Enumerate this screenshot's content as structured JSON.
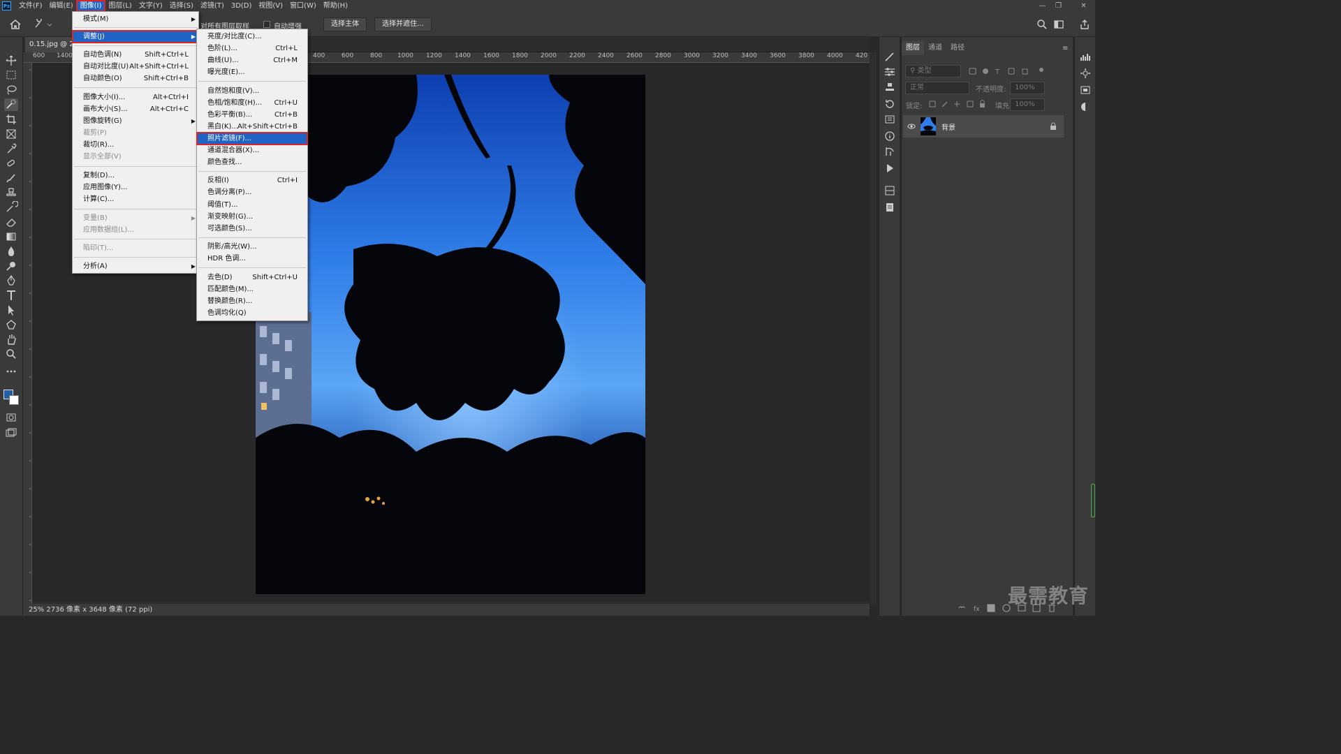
{
  "app": {
    "logo": "Ps"
  },
  "menubar": {
    "items": [
      "文件(F)",
      "编辑(E)",
      "图像(I)",
      "图层(L)",
      "文字(Y)",
      "选择(S)",
      "滤镜(T)",
      "3D(D)",
      "视图(V)",
      "窗口(W)",
      "帮助(H)"
    ],
    "active_index": 2
  },
  "options_bar": {
    "sample_all_layers": "对所有图层取样",
    "auto_enhance": "自动增强",
    "select_subject": "选择主体",
    "select_and_mask": "选择并遮住..."
  },
  "document": {
    "tab_title": "0.15.jpg @ 2",
    "ruler_h": [
      "600",
      "1400",
      "400",
      "600",
      "800",
      "1000",
      "1200",
      "1400",
      "1600",
      "1800",
      "2000",
      "2200",
      "2400",
      "2600",
      "2800",
      "3000",
      "3200",
      "3400",
      "3600",
      "3800",
      "4000",
      "420"
    ],
    "status": "25%   2736 像素 x 3648 像素 (72 ppi)"
  },
  "image_menu": {
    "items": [
      {
        "label": "模式(M)",
        "shortcut": "",
        "submenu": true,
        "disabled": false
      },
      {
        "sep": true
      },
      {
        "label": "调整(J)",
        "shortcut": "",
        "submenu": true,
        "disabled": false,
        "highlight": true
      },
      {
        "sep": true
      },
      {
        "label": "自动色调(N)",
        "shortcut": "Shift+Ctrl+L"
      },
      {
        "label": "自动对比度(U)",
        "shortcut": "Alt+Shift+Ctrl+L"
      },
      {
        "label": "自动颜色(O)",
        "shortcut": "Shift+Ctrl+B"
      },
      {
        "sep": true
      },
      {
        "label": "图像大小(I)...",
        "shortcut": "Alt+Ctrl+I"
      },
      {
        "label": "画布大小(S)...",
        "shortcut": "Alt+Ctrl+C"
      },
      {
        "label": "图像旋转(G)",
        "shortcut": "",
        "submenu": true
      },
      {
        "label": "裁剪(P)",
        "shortcut": "",
        "disabled": true
      },
      {
        "label": "裁切(R)...",
        "shortcut": ""
      },
      {
        "label": "显示全部(V)",
        "shortcut": "",
        "disabled": true
      },
      {
        "sep": true
      },
      {
        "label": "复制(D)...",
        "shortcut": ""
      },
      {
        "label": "应用图像(Y)...",
        "shortcut": ""
      },
      {
        "label": "计算(C)...",
        "shortcut": ""
      },
      {
        "sep": true
      },
      {
        "label": "变量(B)",
        "shortcut": "",
        "submenu": true,
        "disabled": true
      },
      {
        "label": "应用数据组(L)...",
        "shortcut": "",
        "disabled": true
      },
      {
        "sep": true
      },
      {
        "label": "陷印(T)...",
        "shortcut": "",
        "disabled": true
      },
      {
        "sep": true
      },
      {
        "label": "分析(A)",
        "shortcut": "",
        "submenu": true
      }
    ]
  },
  "adjust_menu": {
    "items": [
      {
        "label": "亮度/对比度(C)...",
        "shortcut": ""
      },
      {
        "label": "色阶(L)...",
        "shortcut": "Ctrl+L"
      },
      {
        "label": "曲线(U)...",
        "shortcut": "Ctrl+M"
      },
      {
        "label": "曝光度(E)...",
        "shortcut": ""
      },
      {
        "sep": true
      },
      {
        "label": "自然饱和度(V)...",
        "shortcut": ""
      },
      {
        "label": "色相/饱和度(H)...",
        "shortcut": "Ctrl+U"
      },
      {
        "label": "色彩平衡(B)...",
        "shortcut": "Ctrl+B"
      },
      {
        "label": "黑白(K)...",
        "shortcut": "Alt+Shift+Ctrl+B"
      },
      {
        "label": "照片滤镜(F)...",
        "shortcut": "",
        "highlight": true
      },
      {
        "label": "通道混合器(X)...",
        "shortcut": ""
      },
      {
        "label": "颜色查找...",
        "shortcut": ""
      },
      {
        "sep": true
      },
      {
        "label": "反相(I)",
        "shortcut": "Ctrl+I"
      },
      {
        "label": "色调分离(P)...",
        "shortcut": ""
      },
      {
        "label": "阈值(T)...",
        "shortcut": ""
      },
      {
        "label": "渐变映射(G)...",
        "shortcut": ""
      },
      {
        "label": "可选颜色(S)...",
        "shortcut": ""
      },
      {
        "sep": true
      },
      {
        "label": "阴影/高光(W)...",
        "shortcut": ""
      },
      {
        "label": "HDR 色调...",
        "shortcut": ""
      },
      {
        "sep": true
      },
      {
        "label": "去色(D)",
        "shortcut": "Shift+Ctrl+U"
      },
      {
        "label": "匹配颜色(M)...",
        "shortcut": ""
      },
      {
        "label": "替换颜色(R)...",
        "shortcut": ""
      },
      {
        "label": "色调均化(Q)",
        "shortcut": ""
      }
    ]
  },
  "layers_panel": {
    "tabs": [
      "图层",
      "通道",
      "路径"
    ],
    "kind_placeholder": "类型",
    "blend_mode": "正常",
    "opacity_label": "不透明度:",
    "opacity_value": "100%",
    "lock_label": "锁定:",
    "fill_label": "填充:",
    "fill_value": "100%",
    "layer_name": "背景"
  },
  "watermark": "最需教育",
  "colors": {
    "accent": "#1f63c4",
    "highlight_border": "#e02424"
  }
}
